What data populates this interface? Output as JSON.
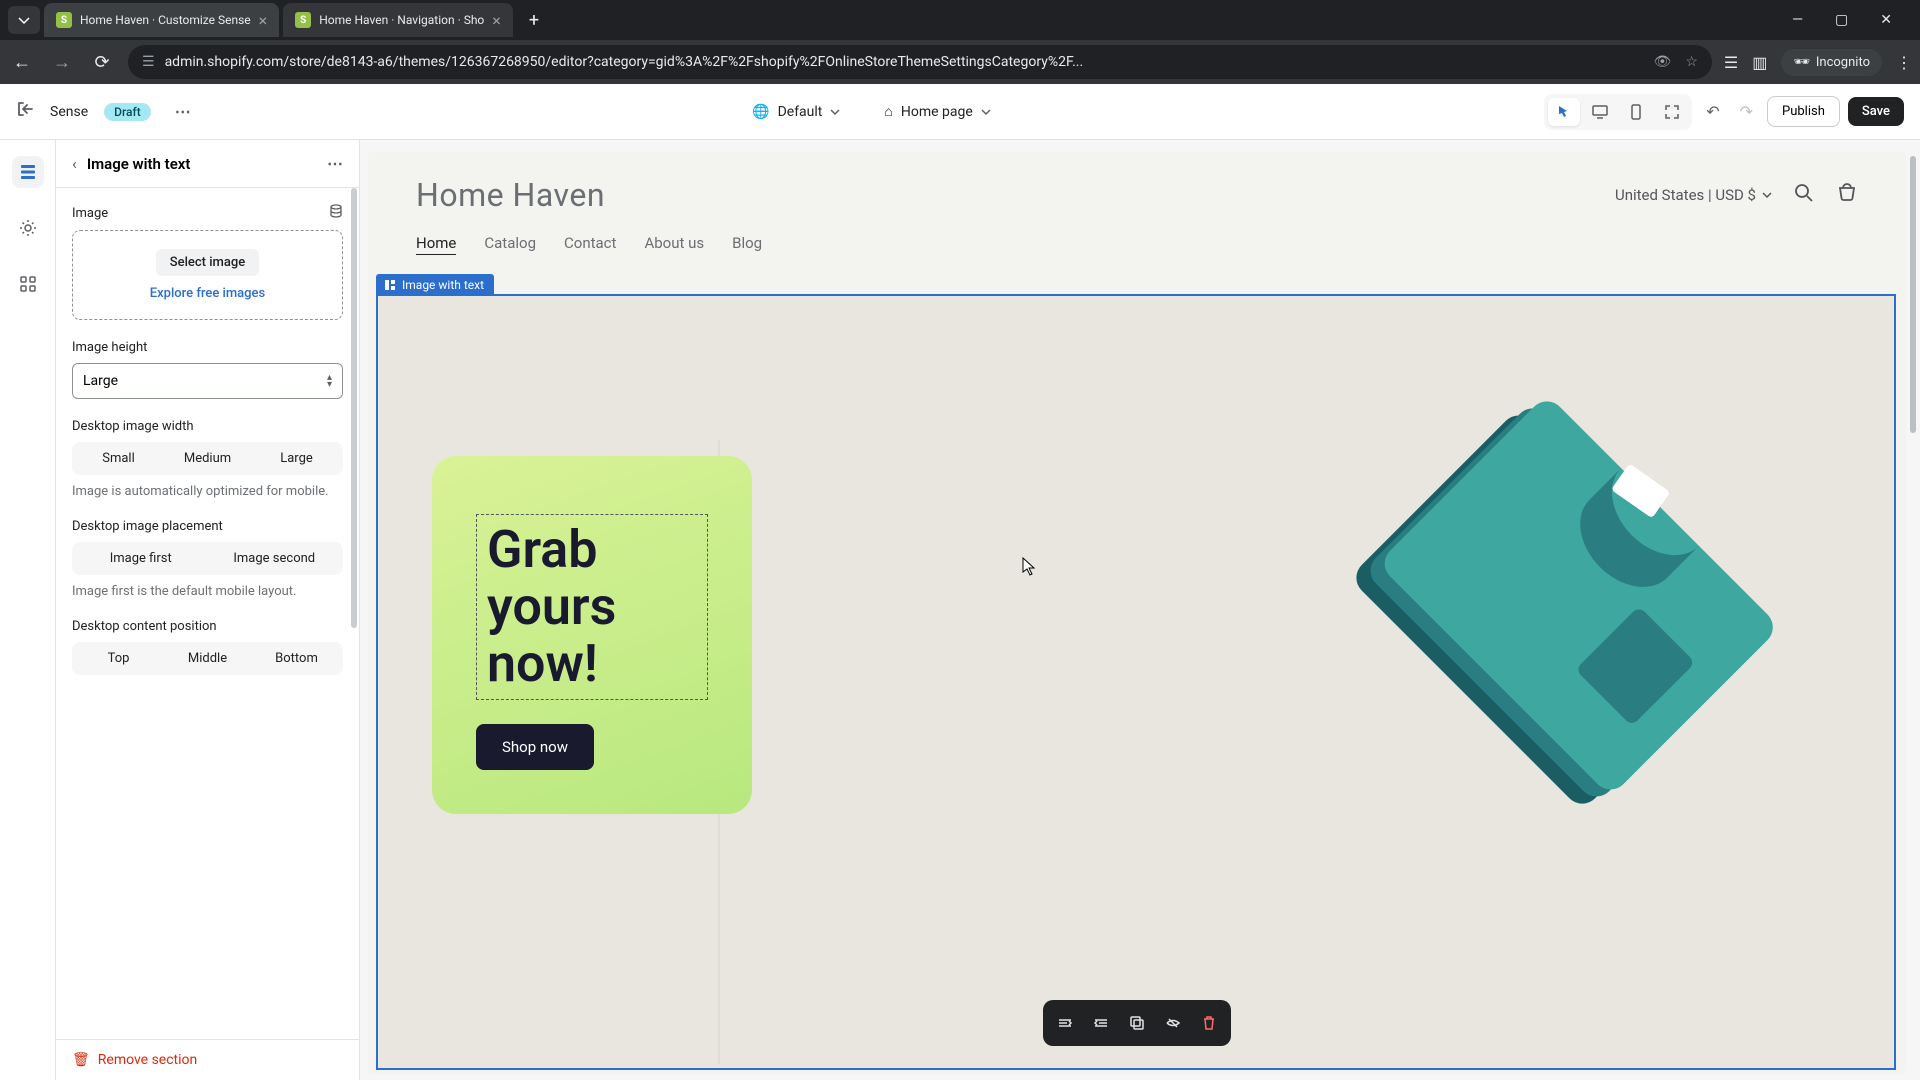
{
  "browser": {
    "tab1": "Home Haven · Customize Sense",
    "tab2": "Home Haven · Navigation · Sho",
    "url": "admin.shopify.com/store/de8143-a6/themes/126367268950/editor?category=gid%3A%2F%2Fshopify%2FOnlineStoreThemeSettingsCategory%2F...",
    "incognito": "Incognito"
  },
  "header": {
    "theme_name": "Sense",
    "draft": "Draft",
    "default": "Default",
    "page": "Home page",
    "publish": "Publish",
    "save": "Save"
  },
  "sidebar": {
    "title": "Image with text",
    "image_label": "Image",
    "select_image": "Select image",
    "explore": "Explore free images",
    "height_label": "Image height",
    "height_value": "Large",
    "width_label": "Desktop image width",
    "width_options": {
      "small": "Small",
      "medium": "Medium",
      "large": "Large"
    },
    "width_helper": "Image is automatically optimized for mobile.",
    "placement_label": "Desktop image placement",
    "placement_options": {
      "first": "Image first",
      "second": "Image second"
    },
    "placement_helper": "Image first is the default mobile layout.",
    "position_label": "Desktop content position",
    "position_options": {
      "top": "Top",
      "middle": "Middle",
      "bottom": "Bottom"
    },
    "remove": "Remove section"
  },
  "preview": {
    "store_name": "Home Haven",
    "currency": "United States | USD $",
    "nav": {
      "home": "Home",
      "catalog": "Catalog",
      "contact": "Contact",
      "about": "About us",
      "blog": "Blog"
    },
    "section_label": "Image with text",
    "headline": "Grab yours now!",
    "cta": "Shop now"
  }
}
